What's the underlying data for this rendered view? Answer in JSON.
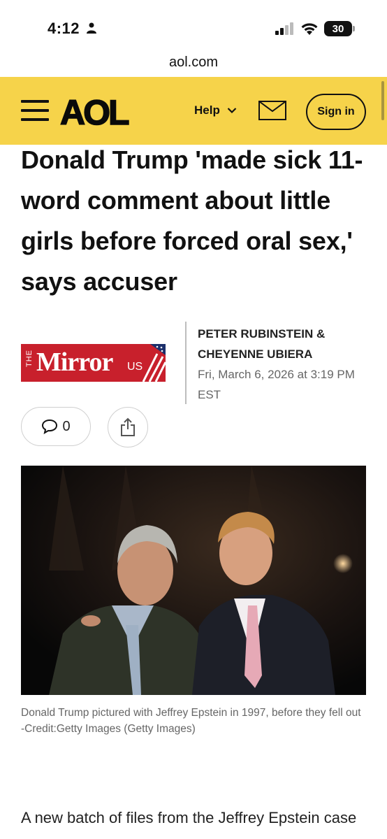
{
  "status_bar": {
    "time": "4:12",
    "battery": "30"
  },
  "browser": {
    "url": "aol.com"
  },
  "header": {
    "logo": "AOL",
    "help_label": "Help",
    "signin_label": "Sign in",
    "accent_color": "#f6d34a"
  },
  "article": {
    "headline": "Donald Trump 'made sick 11-word comment about little girls before forced oral sex,' says accuser",
    "publisher_logo": {
      "prefix": "THE",
      "name": "Mirror",
      "suffix": "US"
    },
    "authors": "PETER RUBINSTEIN & CHEYENNE UBIERA",
    "date": "Fri, March 6, 2026 at 3:19 PM EST",
    "comment_count": "0",
    "caption": "Donald Trump pictured with Jeffrey Epstein in 1997, before they fell out -Credit:Getty Images (Getty Images)",
    "body_first_line": "A new batch of files from the Jeffrey Epstein case includes allegations President Donald"
  },
  "icons": {
    "menu": "hamburger-menu-icon",
    "chevron": "chevron-down-icon",
    "mail": "mail-icon",
    "comment": "comment-icon",
    "share": "share-icon"
  }
}
